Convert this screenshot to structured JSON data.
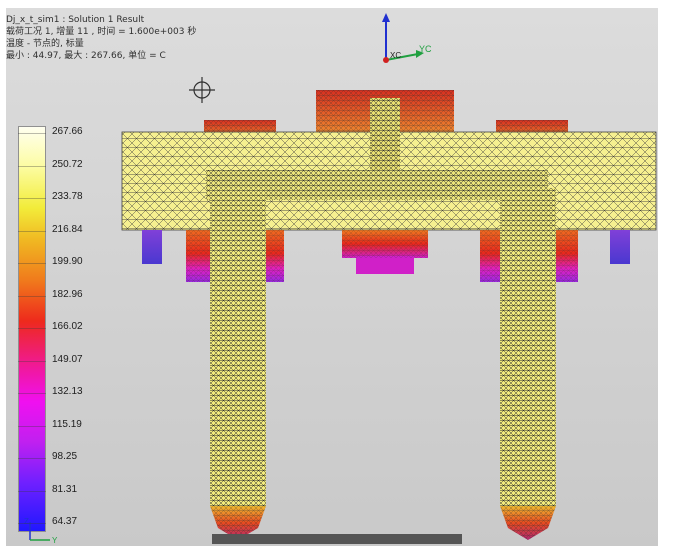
{
  "header": {
    "line1": "Dj_x_t_sim1 : Solution 1 Result",
    "line2": "载荷工况 1, 增量 11 , 时间 = 1.600e+003 秒",
    "line3": "温度 - 节点的, 标量",
    "line4": "最小 : 44.97, 最大 : 267.66, 单位 = C"
  },
  "legend": {
    "ticks": [
      "267.66",
      "250.72",
      "233.78",
      "216.84",
      "199.90",
      "182.96",
      "166.02",
      "149.07",
      "132.13",
      "115.19",
      "98.25",
      "81.31",
      "64.37"
    ]
  },
  "axes": {
    "top_z_label": "ZC",
    "top_y_label": "YC",
    "top_x_label": "XC",
    "bottom_z_label": "Z",
    "bottom_y_label": "Y"
  },
  "colors": {
    "hot": "#fffab0",
    "warm": "#f5e64a",
    "orange": "#f08a20",
    "red": "#e8281c",
    "magenta": "#e020c0",
    "purple": "#6a30e8",
    "mesh": "#3a3a3a"
  }
}
